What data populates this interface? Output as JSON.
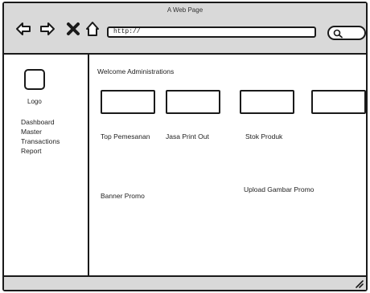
{
  "window": {
    "title": "A Web Page",
    "url": "http://"
  },
  "nav": {
    "icons": [
      "back-icon",
      "forward-icon",
      "close-icon",
      "home-icon"
    ]
  },
  "search": {
    "icon": "search-icon"
  },
  "sidebar": {
    "logo_label": "Logo",
    "items": [
      {
        "label": "Dashboard"
      },
      {
        "label": "Master"
      },
      {
        "label": "Transactions"
      },
      {
        "label": "Report"
      }
    ]
  },
  "main": {
    "welcome": "Welcome Administrations",
    "labels": {
      "top": "Top Pemesanan",
      "jasa": "Jasa Print Out",
      "stok": "Stok Produk",
      "banner": "Banner Promo",
      "upload": "Upload Gambar Promo"
    }
  },
  "colors": {
    "chrome": "#d9d9d9",
    "stroke": "#1a1a1a"
  }
}
